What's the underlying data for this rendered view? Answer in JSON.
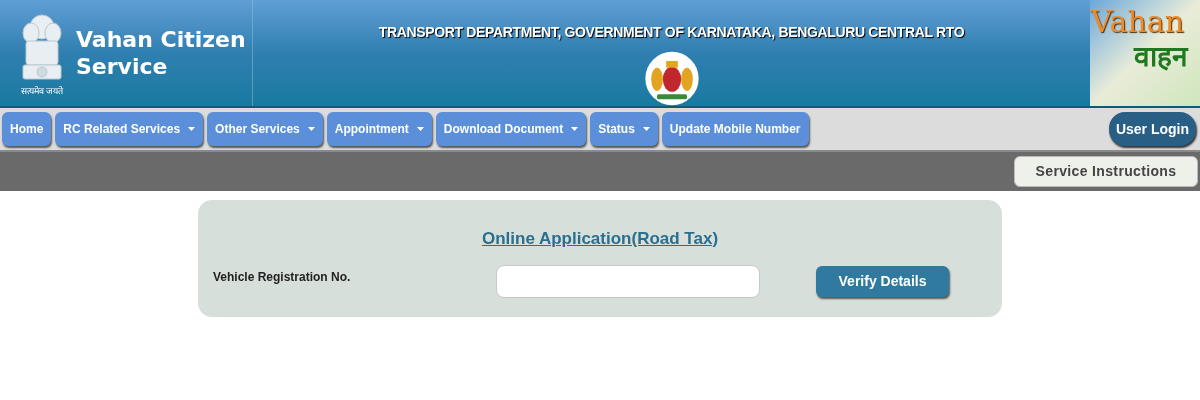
{
  "header": {
    "motto": "सत्यमेव जयते",
    "title_line1": "Vahan Citizen",
    "title_line2": "Service",
    "department": "TRANSPORT DEPARTMENT, GOVERNMENT OF KARNATAKA, BENGALURU CENTRAL RTO",
    "logo_text1": "Vahan",
    "logo_text2": "वाहन"
  },
  "nav": [
    {
      "label": "Home",
      "dropdown": false
    },
    {
      "label": "RC Related Services",
      "dropdown": true
    },
    {
      "label": "Other Services",
      "dropdown": true
    },
    {
      "label": "Appointment",
      "dropdown": true
    },
    {
      "label": "Download Document",
      "dropdown": true
    },
    {
      "label": "Status",
      "dropdown": true
    },
    {
      "label": "Update Mobile Number",
      "dropdown": false
    }
  ],
  "user_login": "User Login",
  "service_instructions": "Service Instructions",
  "form": {
    "title": "Online Application(Road Tax)",
    "field_label": "Vehicle Registration No.",
    "button": "Verify Details"
  }
}
